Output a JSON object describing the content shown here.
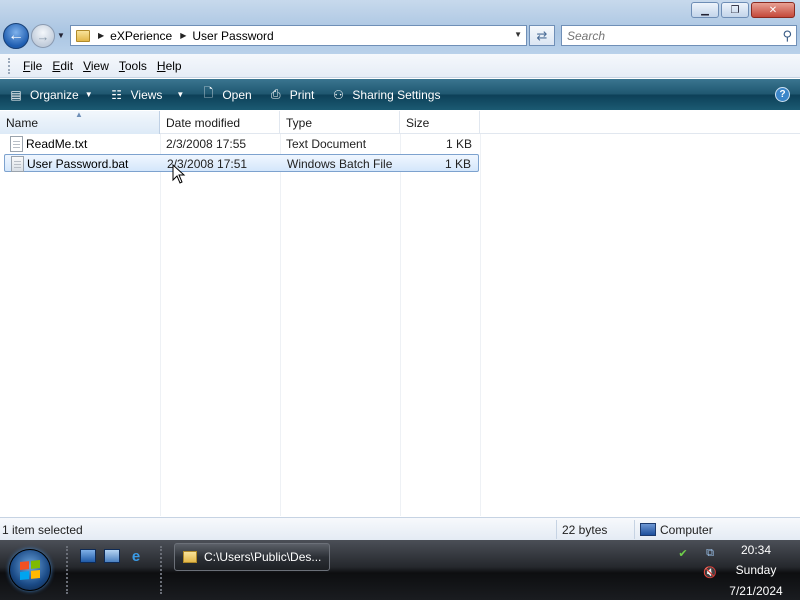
{
  "window": {
    "minimize_glyph": "▁",
    "maximize_glyph": "❐",
    "close_glyph": "✕"
  },
  "navigation": {
    "back_glyph": "←",
    "forward_glyph": "→",
    "breadcrumbs": [
      "eXPerience",
      "User Password"
    ],
    "search_placeholder": "Search"
  },
  "menu": {
    "items": [
      {
        "accel": "F",
        "rest": "ile"
      },
      {
        "accel": "E",
        "rest": "dit"
      },
      {
        "accel": "V",
        "rest": "iew"
      },
      {
        "accel": "T",
        "rest": "ools"
      },
      {
        "accel": "H",
        "rest": "elp"
      }
    ]
  },
  "toolbar": {
    "organize": "Organize",
    "views": "Views",
    "open": "Open",
    "print": "Print",
    "sharing": "Sharing Settings",
    "help_glyph": "?"
  },
  "columns": {
    "name": "Name",
    "date": "Date modified",
    "type": "Type",
    "size": "Size"
  },
  "files": [
    {
      "name": "ReadMe.txt",
      "date": "2/3/2008 17:55",
      "type": "Text Document",
      "size": "1 KB"
    },
    {
      "name": "User Password.bat",
      "date": "2/3/2008 17:51",
      "type": "Windows Batch File",
      "size": "1 KB"
    }
  ],
  "status": {
    "selection": "1 item selected",
    "size": "22 bytes",
    "location": "Computer"
  },
  "taskbar": {
    "window_title": "C:\\Users\\Public\\Des...",
    "time": "20:34",
    "day": "Sunday",
    "date": "7/21/2024"
  },
  "colors": {
    "command_bar": "#1f5770",
    "selection_border": "#7da2ce",
    "start_orb": "#1a4a86"
  }
}
